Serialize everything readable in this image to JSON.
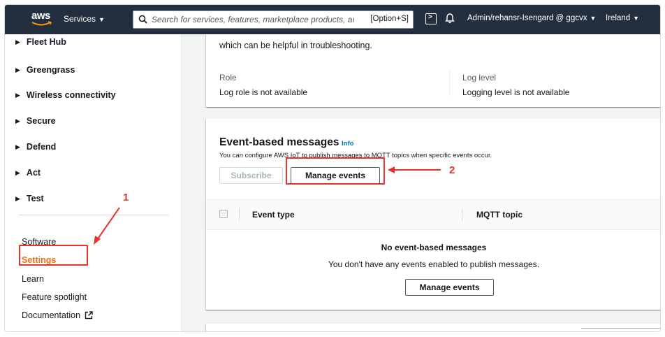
{
  "topnav": {
    "logo_text": "aws",
    "services_label": "Services",
    "search_placeholder": "Search for services, features, marketplace products, aı",
    "search_shortcut": "[Option+S]",
    "account": "Admin/rehansr-Isengard @ ggcvx",
    "region": "Ireland",
    "icons": [
      "search-icon",
      "cloudshell-icon",
      "bell-icon",
      "caret-down-icon"
    ]
  },
  "sidebar": {
    "groups": [
      {
        "label": "Fleet Hub"
      },
      {
        "label": "Greengrass"
      },
      {
        "label": "Wireless connectivity"
      },
      {
        "label": "Secure"
      },
      {
        "label": "Defend"
      },
      {
        "label": "Act"
      },
      {
        "label": "Test"
      }
    ],
    "links": [
      {
        "label": "Software"
      },
      {
        "label": "Settings"
      },
      {
        "label": "Learn"
      },
      {
        "label": "Feature spotlight"
      },
      {
        "label": "Documentation"
      }
    ],
    "active_color": "#ec7211"
  },
  "logs_panel": {
    "intro": "which can be helpful in troubleshooting.",
    "role_label": "Role",
    "role_value": "Log role is not available",
    "level_label": "Log level",
    "level_value": "Logging level is not available"
  },
  "event_panel": {
    "title": "Event-based messages",
    "info": "Info",
    "description": "You can configure AWS IoT to publish messages to MQTT topics when specific events occur.",
    "subscribe_label": "Subscribe",
    "manage_label": "Manage events",
    "columns": [
      "Event type",
      "MQTT topic"
    ],
    "empty_title": "No event-based messages",
    "empty_desc": "You don't have any events enabled to publish messages.",
    "empty_button": "Manage events"
  },
  "annotations": {
    "step1": "1",
    "step2": "2",
    "color": "#e8332a"
  }
}
